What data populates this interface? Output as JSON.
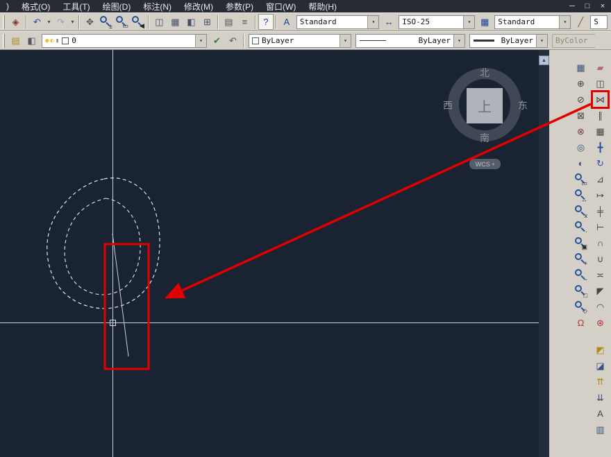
{
  "window": {
    "controls": [
      {
        "name": "minimize-button",
        "glyph": "─"
      },
      {
        "name": "restore-button",
        "glyph": "□"
      },
      {
        "name": "close-button",
        "glyph": "×"
      }
    ]
  },
  "menu": {
    "items": [
      {
        "label": ")"
      },
      {
        "label": "格式(O)"
      },
      {
        "label": "工具(T)"
      },
      {
        "label": "绘图(D)"
      },
      {
        "label": "标注(N)"
      },
      {
        "label": "修改(M)"
      },
      {
        "label": "参数(P)"
      },
      {
        "label": "窗口(W)"
      },
      {
        "label": "帮助(H)"
      }
    ]
  },
  "toolbar_standard": {
    "icons": [
      {
        "name": "sheet-set-manager-icon",
        "glyph": "◈",
        "color": "#7a342a"
      },
      {
        "sep": true
      },
      {
        "name": "undo-icon",
        "glyph": "↶",
        "color": "#2a4f9e"
      },
      {
        "name": "undo-dropdown",
        "glyph": "▾",
        "caret": true
      },
      {
        "name": "redo-icon",
        "glyph": "↷",
        "color": "#9aa1ab"
      },
      {
        "name": "redo-dropdown",
        "glyph": "▾",
        "caret": true
      },
      {
        "sep": true
      },
      {
        "name": "pan-icon",
        "glyph": "✥",
        "color": "#555555"
      },
      {
        "name": "zoom-realtime-icon",
        "mag": true,
        "glyph": "±"
      },
      {
        "name": "zoom-window-icon",
        "mag": true,
        "glyph": "▭"
      },
      {
        "name": "zoom-previous-icon",
        "mag": true,
        "glyph": "◀"
      },
      {
        "sep": true
      },
      {
        "name": "layout-viewports-icon",
        "glyph": "◫",
        "color": "#44506a"
      },
      {
        "name": "named-views-icon",
        "glyph": "▦",
        "color": "#44506a"
      },
      {
        "name": "3d-views-icon",
        "glyph": "◧",
        "color": "#44506a"
      },
      {
        "name": "camera-view-icon",
        "glyph": "⊞",
        "color": "#44506a"
      },
      {
        "sep": true
      },
      {
        "name": "calculator-icon",
        "glyph": "▤",
        "color": "#555555"
      },
      {
        "name": "properties-palette-icon",
        "glyph": "≡",
        "color": "#555555"
      },
      {
        "sep": true
      }
    ],
    "help_label": "?",
    "style_icons": {
      "text": "A",
      "dim": "↔",
      "table": "▦",
      "brush": "╱"
    },
    "combos": {
      "text_style": "Standard",
      "dim_style": "ISO-25",
      "table_style": "Standard",
      "partial": "S"
    }
  },
  "toolbar_layers": {
    "icons": [
      {
        "name": "layer-properties-manager-icon",
        "glyph": "▤",
        "color": "#b08820"
      },
      {
        "name": "layer-states-icon",
        "glyph": "◧",
        "color": "#555566"
      }
    ],
    "state_icons": [
      {
        "glyph": "●",
        "color": "#e8c428"
      },
      {
        "glyph": "◐",
        "color": "#e8c428"
      },
      {
        "glyph": "▮",
        "color": "#8a8f98"
      }
    ],
    "layer_name": "0",
    "after_icons": [
      {
        "name": "make-object-layer-current-icon",
        "glyph": "✔",
        "color": "#3a7a3a"
      },
      {
        "name": "layer-previous-icon",
        "glyph": "↶",
        "color": "#555566"
      }
    ],
    "color": "ByLayer",
    "linetype": "ByLayer",
    "lineweight": "ByLayer",
    "plot_style": "ByColor"
  },
  "canvas": {
    "compass": {
      "north": "北",
      "west": "西",
      "east": "东",
      "south": "南",
      "center": "上"
    },
    "wcs_label": "WCS",
    "background_color": "#1a2331",
    "crosshair_color": "#ccd2da",
    "sketch_color": "#e6e6e6"
  },
  "annotations": {
    "highlight_color": "#e10000",
    "highlighted_tool": "mirror-icon"
  },
  "dock": {
    "left_column": [
      {
        "name": "edit-hatch-icon",
        "glyph": "▦",
        "color": "#35517e"
      },
      {
        "name": "point-style-icon",
        "glyph": "⊕",
        "color": "#444444"
      },
      {
        "name": "divide-icon",
        "glyph": "⊘",
        "color": "#444444"
      },
      {
        "name": "clip-icon",
        "glyph": "⊠",
        "color": "#444444"
      },
      {
        "name": "delete-icon",
        "glyph": "⊗",
        "color": "#7a3a3a"
      },
      {
        "name": "3d-orbit-icon",
        "glyph": "◎",
        "color": "#35517e"
      },
      {
        "name": "shade-icon",
        "glyph": "◐",
        "color": "#35517e"
      },
      {
        "name": "zoom-window-icon",
        "mag": true,
        "glyph": "▭"
      },
      {
        "name": "zoom-dynamic-icon",
        "mag": true,
        "glyph": "↔"
      },
      {
        "name": "zoom-scale-icon",
        "mag": true,
        "glyph": "x"
      },
      {
        "name": "zoom-center-icon",
        "mag": true,
        "glyph": "·"
      },
      {
        "name": "zoom-object-icon",
        "mag": true,
        "glyph": "▣"
      },
      {
        "name": "zoom-in-icon",
        "mag": true,
        "glyph": "+"
      },
      {
        "name": "zoom-out-icon",
        "mag": true,
        "glyph": "−"
      },
      {
        "name": "zoom-all-icon",
        "mag": true,
        "glyph": "□"
      },
      {
        "name": "zoom-extents-icon",
        "mag": true,
        "glyph": "◇"
      },
      {
        "name": "object-snap-icon",
        "glyph": "Ω",
        "color": "#b03030"
      }
    ],
    "modify_column": [
      {
        "name": "erase-icon",
        "glyph": "▰",
        "color": "#b5687e"
      },
      {
        "name": "copy-icon",
        "glyph": "◫",
        "color": "#444444"
      },
      {
        "name": "mirror-icon",
        "glyph": "⋈",
        "color": "#444444",
        "hl": true
      },
      {
        "name": "offset-icon",
        "glyph": "∥",
        "color": "#444444"
      },
      {
        "name": "array-icon",
        "glyph": "▦",
        "color": "#444444"
      },
      {
        "name": "move-icon",
        "glyph": "╋",
        "color": "#2a4f9e"
      },
      {
        "name": "rotate-icon",
        "glyph": "↻",
        "color": "#2a4f9e"
      },
      {
        "name": "scale-icon",
        "glyph": "⊿",
        "color": "#444444"
      },
      {
        "name": "stretch-icon",
        "glyph": "↦",
        "color": "#444444"
      },
      {
        "name": "trim-icon",
        "glyph": "╪",
        "color": "#444444"
      },
      {
        "name": "extend-icon",
        "glyph": "⊢",
        "color": "#444444"
      },
      {
        "name": "break-at-point-icon",
        "glyph": "∩",
        "color": "#444444"
      },
      {
        "name": "break-icon",
        "glyph": "∪",
        "color": "#444444"
      },
      {
        "name": "join-icon",
        "glyph": "≍",
        "color": "#444444"
      },
      {
        "name": "chamfer-icon",
        "glyph": "◤",
        "color": "#444444"
      },
      {
        "name": "fillet-icon",
        "glyph": "◠",
        "color": "#444444"
      },
      {
        "name": "explode-icon",
        "glyph": "⊛",
        "color": "#b03030"
      }
    ],
    "order_column": [
      {
        "name": "bring-to-front-icon",
        "glyph": "◩",
        "color": "#b08820"
      },
      {
        "name": "send-to-back-icon",
        "glyph": "◪",
        "color": "#35517e"
      },
      {
        "name": "bring-above-objects-icon",
        "glyph": "⇈",
        "color": "#b08820"
      },
      {
        "name": "send-under-objects-icon",
        "glyph": "⇊",
        "color": "#35517e"
      },
      {
        "name": "text-icon",
        "glyph": "A",
        "color": "#444444"
      },
      {
        "name": "draw-order-icon",
        "glyph": "▥",
        "color": "#35517e"
      }
    ]
  }
}
